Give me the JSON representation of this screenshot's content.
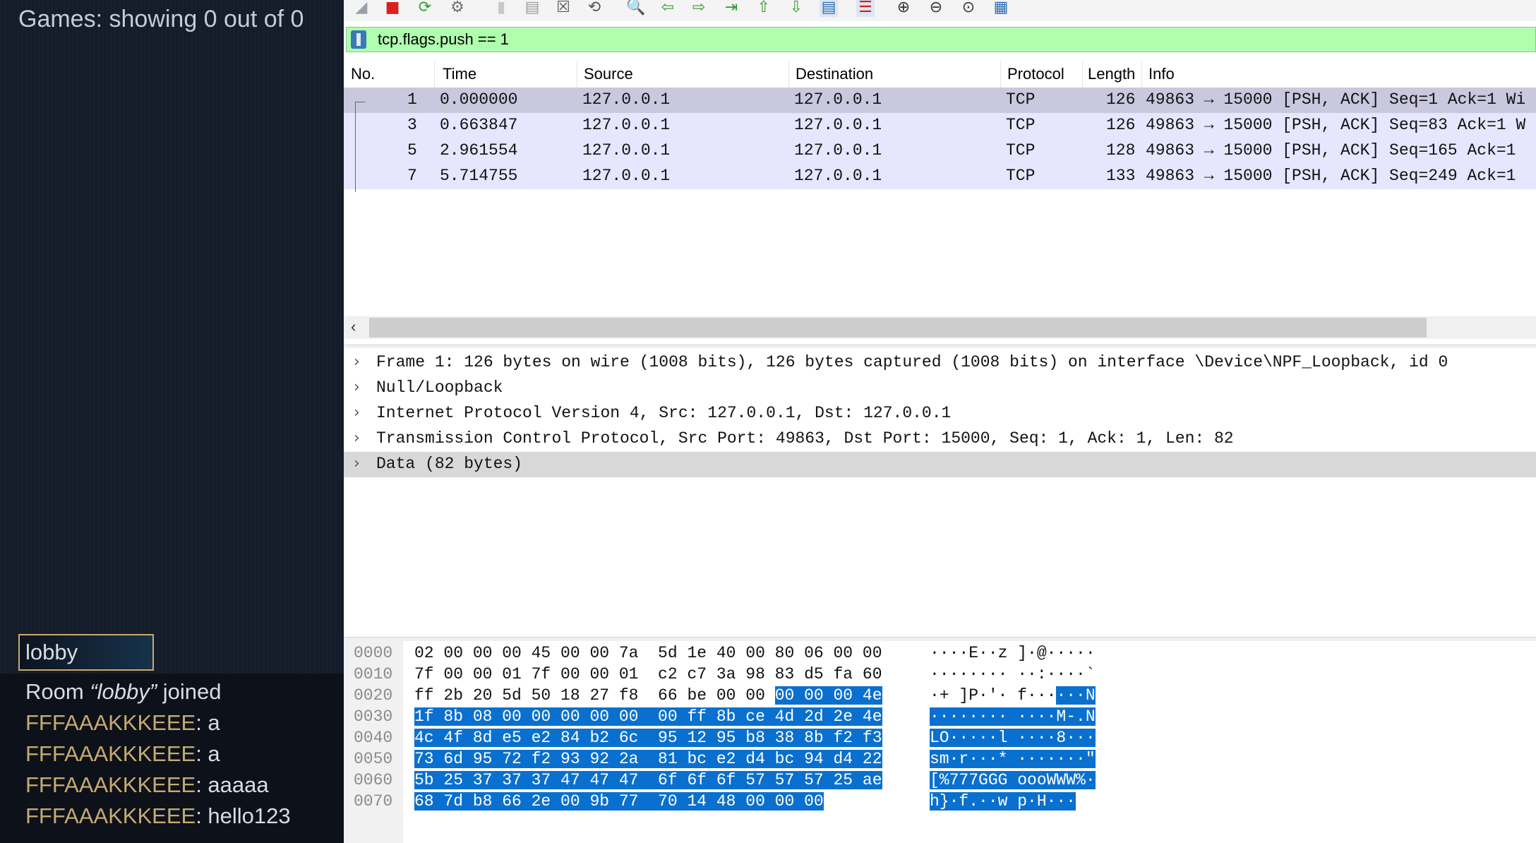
{
  "left_panel": {
    "games_status": "Games: showing 0 out of 0",
    "room_input_value": "lobby",
    "chat": [
      {
        "type": "system",
        "prefix": "Room ",
        "room": "“lobby”",
        "suffix": " joined"
      },
      {
        "type": "message",
        "user": "FFFAAAKKKEEE",
        "text": ": a"
      },
      {
        "type": "message",
        "user": "FFFAAAKKKEEE",
        "text": ": a"
      },
      {
        "type": "message",
        "user": "FFFAAAKKKEEE",
        "text": ": aaaaa"
      },
      {
        "type": "message",
        "user": "FFFAAAKKKEEE",
        "text": ": hello123"
      }
    ],
    "colors": {
      "panel_bg": "#141c2b",
      "username": "#c8aa6e",
      "input_border": "#c8aa6e"
    }
  },
  "toolbar": {
    "icons": [
      "shark-fin-icon",
      "stop-capture-icon",
      "restart-capture-icon",
      "capture-options-icon",
      "open-file-icon",
      "save-file-icon",
      "close-file-icon",
      "reload-file-icon",
      "find-packet-icon",
      "go-back-icon",
      "go-forward-icon",
      "go-to-packet-icon",
      "first-packet-icon",
      "last-packet-icon",
      "auto-scroll-icon",
      "colorize-icon",
      "zoom-in-icon",
      "zoom-out-icon",
      "normal-size-icon",
      "resize-columns-icon"
    ]
  },
  "filter": {
    "text": "tcp.flags.push == 1",
    "bg_color": "#afffaf"
  },
  "packet_list": {
    "columns": [
      "No.",
      "Time",
      "Source",
      "Destination",
      "Protocol",
      "Length",
      "Info"
    ],
    "rows": [
      {
        "no": "1",
        "time": "0.000000",
        "source": "127.0.0.1",
        "destination": "127.0.0.1",
        "protocol": "TCP",
        "length": "126",
        "info": "49863 → 15000 [PSH, ACK] Seq=1 Ack=1 Wi"
      },
      {
        "no": "3",
        "time": "0.663847",
        "source": "127.0.0.1",
        "destination": "127.0.0.1",
        "protocol": "TCP",
        "length": "126",
        "info": "49863 → 15000 [PSH, ACK] Seq=83 Ack=1 W"
      },
      {
        "no": "5",
        "time": "2.961554",
        "source": "127.0.0.1",
        "destination": "127.0.0.1",
        "protocol": "TCP",
        "length": "128",
        "info": "49863 → 15000 [PSH, ACK] Seq=165 Ack=1"
      },
      {
        "no": "7",
        "time": "5.714755",
        "source": "127.0.0.1",
        "destination": "127.0.0.1",
        "protocol": "TCP",
        "length": "133",
        "info": "49863 → 15000 [PSH, ACK] Seq=249 Ack=1"
      }
    ],
    "row_color": "#e7e6ff",
    "selected_row_color": "#c9c8de"
  },
  "details": [
    "Frame 1: 126 bytes on wire (1008 bits), 126 bytes captured (1008 bits) on interface \\Device\\NPF_Loopback, id 0",
    "Null/Loopback",
    "Internet Protocol Version 4, Src: 127.0.0.1, Dst: 127.0.0.1",
    "Transmission Control Protocol, Src Port: 49863, Dst Port: 15000, Seq: 1, Ack: 1, Len: 82",
    "Data (82 bytes)"
  ],
  "bytes_pane": {
    "highlight_color": "#0a70cf",
    "lines": [
      {
        "offset": "0000",
        "hex_plain": "02 00 00 00 45 00 00 7a  5d 1e 40 00 80 06 00 00",
        "hex_hl": "",
        "ascii_plain": "····E··z ]·@·····",
        "ascii_hl": ""
      },
      {
        "offset": "0010",
        "hex_plain": "7f 00 00 01 7f 00 00 01  c2 c7 3a 98 83 d5 fa 60",
        "hex_hl": "",
        "ascii_plain": "········ ··:····`",
        "ascii_hl": ""
      },
      {
        "offset": "0020",
        "hex_plain": "ff 2b 20 5d 50 18 27 f8  66 be 00 00 ",
        "hex_hl": "00 00 00 4e",
        "ascii_plain": "·+ ]P·'· f···",
        "ascii_hl": "···N"
      },
      {
        "offset": "0030",
        "hex_plain": "",
        "hex_hl": "1f 8b 08 00 00 00 00 00  00 ff 8b ce 4d 2d 2e 4e",
        "ascii_plain": "",
        "ascii_hl": "········ ····M-.N"
      },
      {
        "offset": "0040",
        "hex_plain": "",
        "hex_hl": "4c 4f 8d e5 e2 84 b2 6c  95 12 95 b8 38 8b f2 f3",
        "ascii_plain": "",
        "ascii_hl": "LO·····l ····8···"
      },
      {
        "offset": "0050",
        "hex_plain": "",
        "hex_hl": "73 6d 95 72 f2 93 92 2a  81 bc e2 d4 bc 94 d4 22",
        "ascii_plain": "",
        "ascii_hl": "sm·r···* ·······\""
      },
      {
        "offset": "0060",
        "hex_plain": "",
        "hex_hl": "5b 25 37 37 37 47 47 47  6f 6f 6f 57 57 57 25 ae",
        "ascii_plain": "",
        "ascii_hl": "[%777GGG oooWWW%·"
      },
      {
        "offset": "0070",
        "hex_plain": "",
        "hex_hl": "68 7d b8 66 2e 00 9b 77  70 14 48 00 00 00",
        "ascii_plain": "",
        "ascii_hl": "h}·f.··w p·H···"
      }
    ]
  }
}
